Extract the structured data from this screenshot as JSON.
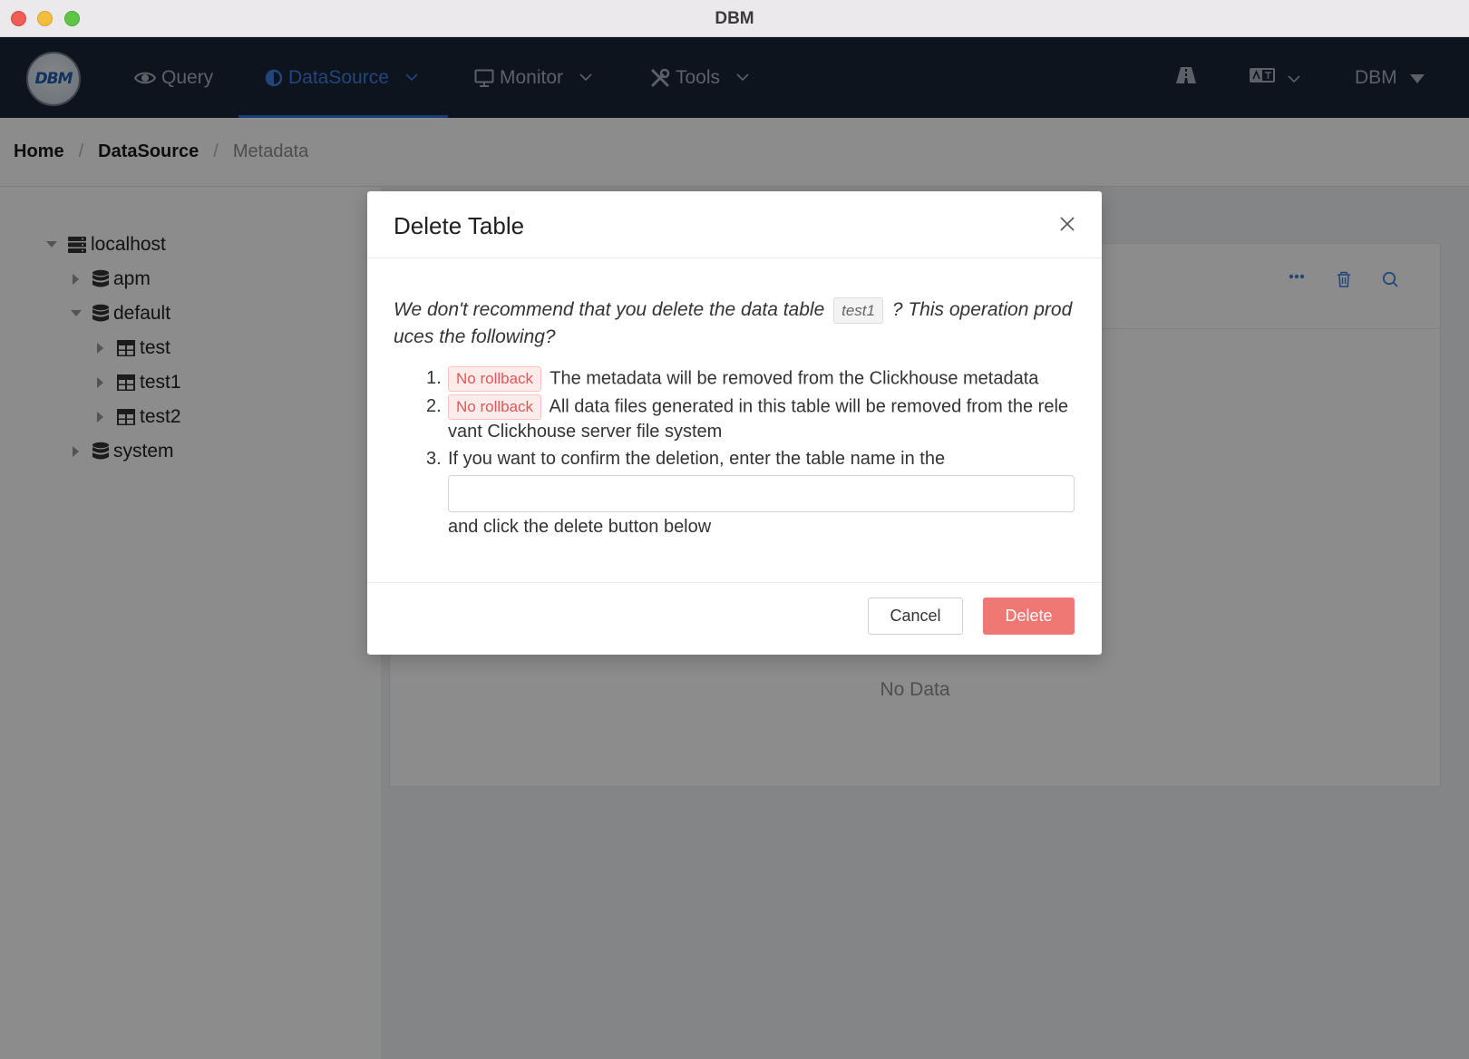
{
  "window": {
    "title": "DBM"
  },
  "logo": {
    "text": "DBM"
  },
  "nav": {
    "items": [
      {
        "label": "Query",
        "icon": "eye-icon",
        "active": false
      },
      {
        "label": "DataSource",
        "icon": "half-circle-icon",
        "active": true
      },
      {
        "label": "Monitor",
        "icon": "monitor-icon",
        "active": false
      },
      {
        "label": "Tools",
        "icon": "tools-icon",
        "active": false
      }
    ],
    "user_label": "DBM",
    "colors": {
      "background": "#1b2535",
      "active": "#3f7fe2",
      "text": "#a8b0bc"
    }
  },
  "breadcrumb": {
    "items": [
      "Home",
      "DataSource"
    ],
    "current": "Metadata"
  },
  "tree": {
    "nodes": [
      {
        "label": "localhost",
        "icon": "server-icon",
        "expanded": true
      },
      {
        "label": "apm",
        "icon": "database-icon",
        "expanded": false
      },
      {
        "label": "default",
        "icon": "database-icon",
        "expanded": true
      },
      {
        "label": "test",
        "icon": "table-icon",
        "expanded": false
      },
      {
        "label": "test1",
        "icon": "table-icon",
        "expanded": false
      },
      {
        "label": "test2",
        "icon": "table-icon",
        "expanded": false
      },
      {
        "label": "system",
        "icon": "database-icon",
        "expanded": false
      }
    ]
  },
  "panel": {
    "empty_text": "No Data"
  },
  "modal": {
    "title": "Delete Table",
    "intro_before": "We don't recommend that you delete the data table",
    "table_name": "test1",
    "intro_after": "? This operation produces the following?",
    "steps": [
      {
        "tag": "No rollback",
        "text": "The metadata will be removed from the Clickhouse metadata"
      },
      {
        "tag": "No rollback",
        "text": "All data files generated in this table will be removed from the relevant Clickhouse server file system"
      },
      {
        "text_before": "If you want to confirm the deletion, enter the table name in the",
        "input_value": "",
        "text_after": "and click the delete button below"
      }
    ],
    "cancel_label": "Cancel",
    "delete_label": "Delete",
    "colors": {
      "delete": "#ef7774",
      "warn_tag": "#e0575a"
    }
  }
}
